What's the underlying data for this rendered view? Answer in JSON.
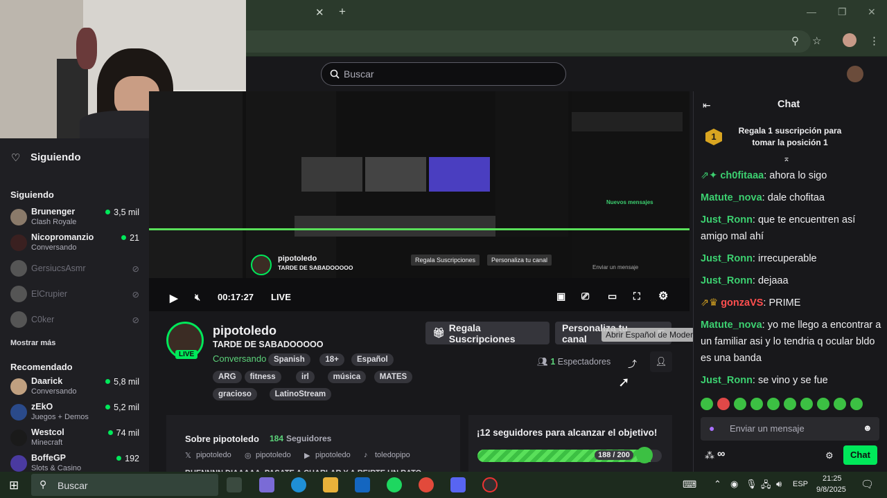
{
  "browser": {
    "tab_close": "✕",
    "new_tab": "+"
  },
  "twitch": {
    "search_placeholder": "Buscar"
  },
  "sidebar": {
    "following_header": "Siguiendo",
    "following_label": "Siguiendo",
    "following": [
      {
        "name": "Brunenger",
        "game": "Clash Royale",
        "viewers": "3,5 mil",
        "color": "#8a7a6a",
        "live": true
      },
      {
        "name": "Nicopromanzio",
        "game": "Conversando",
        "viewers": "21",
        "color": "#3a2020",
        "live": true
      },
      {
        "name": "GersiucsAsmr",
        "game": "",
        "viewers": "",
        "color": "#555",
        "live": false
      },
      {
        "name": "ElCrupier",
        "game": "",
        "viewers": "",
        "color": "#555",
        "live": false
      },
      {
        "name": "C0ker",
        "game": "",
        "viewers": "",
        "color": "#555",
        "live": false
      }
    ],
    "show_more": "Mostrar más",
    "recommended_label": "Recomendado",
    "recommended": [
      {
        "name": "Daarick",
        "game": "Conversando",
        "viewers": "5,8 mil",
        "color": "#c0a080"
      },
      {
        "name": "zEkO",
        "game": "Juegos + Demos",
        "viewers": "5,2 mil",
        "color": "#2a4a8a"
      },
      {
        "name": "Westcol",
        "game": "Minecraft",
        "viewers": "74 mil",
        "color": "#1a1a1a"
      },
      {
        "name": "BoffeGP",
        "game": "Slots & Casino",
        "viewers": "192",
        "color": "#4a3aa0"
      }
    ]
  },
  "player": {
    "time": "00:17:27",
    "live": "LIVE"
  },
  "nested_stream": {
    "channel": "pipotoledo",
    "title": "TARDE DE SABADOOOOO",
    "btn_gift": "Regala Suscripciones",
    "btn_custom": "Personaliza tu canal",
    "chat_new_messages": "Nuevos mensajes",
    "chat_send": "Enviar un mensaje"
  },
  "stream": {
    "channel": "pipotoledo",
    "title": "TARDE DE SABADOOOOO",
    "live_badge": "LIVE",
    "category": "Conversando",
    "tags_row1": [
      "Spanish",
      "18+",
      "Español"
    ],
    "tags_row2": [
      "ARG",
      "fitness",
      "irl",
      "música",
      "MATES"
    ],
    "tags_row3": [
      "gracioso",
      "LatinoStream"
    ],
    "btn_gift": "Regala Suscripciones",
    "btn_custom": "Personaliza tu canal",
    "tooltip": "Abrir Español de Moderación",
    "viewers": "1",
    "viewers_label": "Espectadores"
  },
  "about": {
    "title": "Sobre pipotoledo",
    "followers": "184",
    "followers_label": "Seguidores",
    "socials": [
      "pipotoledo",
      "pipotoledo",
      "pipotoledo",
      "toledopipo"
    ],
    "bio_start": "BUENNNN DIAAAAA, PASATE A CHARLAR Y A REIRTE UN RATO"
  },
  "goal": {
    "title": "¡12 seguidores para alcanzar el objetivo!",
    "progress": "188 / 200",
    "fraction": 0.94
  },
  "chat": {
    "header": "Chat",
    "pinned": "Regala 1 suscripción para tomar la posición 1",
    "pinned_rank": "1",
    "messages": [
      {
        "user": "ch0fitaaa",
        "color": "#3cd070",
        "text": "ahora lo sigo"
      },
      {
        "user": "Matute_nova",
        "color": "#3cd070",
        "text": "dale chofitaa"
      },
      {
        "user": "Just_Ronn",
        "color": "#3cd070",
        "text": "que te encuentren así amigo mal ahí"
      },
      {
        "user": "Just_Ronn",
        "color": "#3cd070",
        "text": "irrecuperable"
      },
      {
        "user": "Just_Ronn",
        "color": "#3cd070",
        "text": "dejaaa"
      },
      {
        "user": "gonzaVS",
        "color": "#ff4f4f",
        "text": "PRIME"
      },
      {
        "user": "Matute_nova",
        "color": "#3cd070",
        "text": "yo me llego a encontrar a un familiar asi y lo tendria q ocular bldo es una banda"
      },
      {
        "user": "Just_Ronn",
        "color": "#3cd070",
        "text": "se vino y se fue"
      }
    ],
    "input_placeholder": "Enviar un mensaje",
    "points": "∞",
    "send_button": "Chat"
  },
  "taskbar": {
    "search": "Buscar",
    "lang": "ESP",
    "time": "21:25",
    "date": "9/8/2025"
  }
}
